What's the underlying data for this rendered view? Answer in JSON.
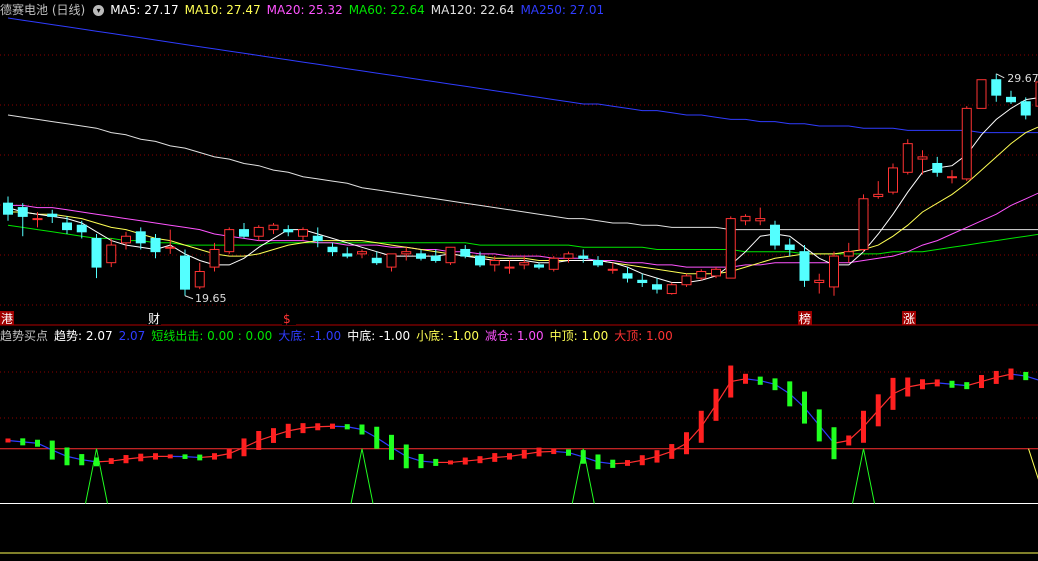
{
  "colors": {
    "up": "#ff3333",
    "down": "#54ffff",
    "ma5": "#ffffff",
    "ma10": "#ffff54",
    "ma20": "#ff54ff",
    "ma60": "#00e600",
    "ma120": "#e0e0e0",
    "ma250": "#2f3cff",
    "grid": "#8b0000",
    "trend_up": "#ff2020",
    "trend_down": "#20ff20",
    "ref_line": "#ff3030",
    "base_line": "#ffffff"
  },
  "header": {
    "title": "德赛电池 (日线)",
    "dropdown_icon": "chevron-down-icon",
    "ma5": "MA5: 27.17",
    "ma10": "MA10: 27.47",
    "ma20": "MA20: 25.32",
    "ma60": "MA60: 22.64",
    "ma120": "MA120: 22.64",
    "ma250": "MA250: 27.01"
  },
  "price_annotations": {
    "high": "29.67",
    "low": "19.65"
  },
  "event_markers": [
    "港",
    "财",
    "$",
    "榜",
    "涨"
  ],
  "indicator_header": {
    "name": "趋势买点",
    "trend": "趋势: 2.07",
    "trend2": "2.07",
    "short_exit": "短线出击: 0.00 : 0.00",
    "big_bottom": "大底: -1.00",
    "mid_bottom": "中底: -1.00",
    "small_bottom": "小底: -1.00",
    "reduce": "减仓: 1.00",
    "mid_top": "中顶: 1.00",
    "big_top": "大顶: 1.00"
  },
  "chart_data": {
    "type": "candlestick",
    "price_panel": {
      "ylim": [
        18.5,
        32.2
      ],
      "candles": [
        [
          23.8,
          24.1,
          23.0,
          23.3
        ],
        [
          23.6,
          23.8,
          22.3,
          23.2
        ],
        [
          23.1,
          23.4,
          22.7,
          23.1
        ],
        [
          23.3,
          23.5,
          22.9,
          23.2
        ],
        [
          22.9,
          23.2,
          22.4,
          22.6
        ],
        [
          22.8,
          23.0,
          22.2,
          22.5
        ],
        [
          22.2,
          22.4,
          20.4,
          20.9
        ],
        [
          21.1,
          22.2,
          20.9,
          21.9
        ],
        [
          22.0,
          22.5,
          21.7,
          22.3
        ],
        [
          22.5,
          22.7,
          21.7,
          22.0
        ],
        [
          22.2,
          22.4,
          21.3,
          21.6
        ],
        [
          21.8,
          22.6,
          21.5,
          21.8
        ],
        [
          21.4,
          21.7,
          19.6,
          19.9
        ],
        [
          20.0,
          21.1,
          19.9,
          20.7
        ],
        [
          20.9,
          22.0,
          20.7,
          21.7
        ],
        [
          21.6,
          22.7,
          21.5,
          22.6
        ],
        [
          22.6,
          22.9,
          22.2,
          22.3
        ],
        [
          22.3,
          22.8,
          22.1,
          22.7
        ],
        [
          22.6,
          22.9,
          22.4,
          22.8
        ],
        [
          22.6,
          22.8,
          22.3,
          22.5
        ],
        [
          22.3,
          22.7,
          22.1,
          22.6
        ],
        [
          22.3,
          22.7,
          21.8,
          22.1
        ],
        [
          21.8,
          22.0,
          21.4,
          21.6
        ],
        [
          21.5,
          21.8,
          21.3,
          21.4
        ],
        [
          21.5,
          21.7,
          21.3,
          21.6
        ],
        [
          21.3,
          21.6,
          21.0,
          21.1
        ],
        [
          20.9,
          21.5,
          20.7,
          21.5
        ],
        [
          21.5,
          21.8,
          21.2,
          21.6
        ],
        [
          21.5,
          21.7,
          21.2,
          21.3
        ],
        [
          21.4,
          21.7,
          21.1,
          21.2
        ],
        [
          21.1,
          21.8,
          21.0,
          21.8
        ],
        [
          21.7,
          21.9,
          21.3,
          21.4
        ],
        [
          21.4,
          21.6,
          20.9,
          21.0
        ],
        [
          21.0,
          21.4,
          20.7,
          21.2
        ],
        [
          20.9,
          21.2,
          20.6,
          20.9
        ],
        [
          21.0,
          21.4,
          20.8,
          21.1
        ],
        [
          21.0,
          21.1,
          20.8,
          20.9
        ],
        [
          20.8,
          21.4,
          20.7,
          21.3
        ],
        [
          21.3,
          21.6,
          21.1,
          21.5
        ],
        [
          21.4,
          21.7,
          21.1,
          21.3
        ],
        [
          21.2,
          21.4,
          20.9,
          21.0
        ],
        [
          20.8,
          21.1,
          20.6,
          20.8
        ],
        [
          20.6,
          20.9,
          20.2,
          20.4
        ],
        [
          20.3,
          20.6,
          20.0,
          20.2
        ],
        [
          20.1,
          20.4,
          19.7,
          19.9
        ],
        [
          19.7,
          20.2,
          19.65,
          20.1
        ],
        [
          20.1,
          20.6,
          20.0,
          20.5
        ],
        [
          20.4,
          20.8,
          20.3,
          20.7
        ],
        [
          20.5,
          20.9,
          20.4,
          20.8
        ],
        [
          20.4,
          23.2,
          20.4,
          23.1
        ],
        [
          23.0,
          23.3,
          22.8,
          23.2
        ],
        [
          23.0,
          23.6,
          22.8,
          23.1
        ],
        [
          22.8,
          23.0,
          21.7,
          21.9
        ],
        [
          21.9,
          22.2,
          21.4,
          21.7
        ],
        [
          21.6,
          21.9,
          20.0,
          20.3
        ],
        [
          20.2,
          20.6,
          19.7,
          20.3
        ],
        [
          20.0,
          21.6,
          19.6,
          21.4
        ],
        [
          21.4,
          22.0,
          21.1,
          21.6
        ],
        [
          21.7,
          24.2,
          21.6,
          24.0
        ],
        [
          24.1,
          24.8,
          24.0,
          24.2
        ],
        [
          24.3,
          25.6,
          24.2,
          25.4
        ],
        [
          25.2,
          26.7,
          25.1,
          26.5
        ],
        [
          25.8,
          26.2,
          25.1,
          25.9
        ],
        [
          25.6,
          25.9,
          25.0,
          25.2
        ],
        [
          25.0,
          25.3,
          24.7,
          25.0
        ],
        [
          24.9,
          28.2,
          24.8,
          28.1
        ],
        [
          28.1,
          29.4,
          28.1,
          29.4
        ],
        [
          29.4,
          29.67,
          28.4,
          28.7
        ],
        [
          28.6,
          28.9,
          28.3,
          28.4
        ],
        [
          28.4,
          28.6,
          27.6,
          27.8
        ],
        [
          28.2,
          29.4,
          28.0,
          29.3
        ],
        [
          28.9,
          29.0,
          27.5,
          27.8
        ],
        [
          26.7,
          27.3,
          26.4,
          27.0
        ],
        [
          26.9,
          27.1,
          25.8,
          26.1
        ]
      ],
      "ma5": [
        23.6,
        23.4,
        23.3,
        23.2,
        23.1,
        22.9,
        22.5,
        22.1,
        21.9,
        21.8,
        21.7,
        21.9,
        21.5,
        21.2,
        21.0,
        21.0,
        21.3,
        21.8,
        22.2,
        22.6,
        22.6,
        22.4,
        22.2,
        22.0,
        21.8,
        21.6,
        21.4,
        21.4,
        21.4,
        21.4,
        21.5,
        21.4,
        21.3,
        21.2,
        21.2,
        21.2,
        21.1,
        21.1,
        21.2,
        21.2,
        21.2,
        21.1,
        20.9,
        20.6,
        20.4,
        20.2,
        20.2,
        20.3,
        20.5,
        21.0,
        21.6,
        22.3,
        22.4,
        22.3,
        21.8,
        21.3,
        21.0,
        21.0,
        21.6,
        22.4,
        23.3,
        24.3,
        25.2,
        25.4,
        25.5,
        26.0,
        26.9,
        27.6,
        28.1,
        28.5,
        28.6,
        28.4,
        28.1,
        27.6
      ],
      "ma10": [
        23.4,
        23.4,
        23.3,
        23.3,
        23.2,
        23.1,
        22.9,
        22.7,
        22.6,
        22.4,
        22.2,
        22.1,
        21.9,
        21.7,
        21.5,
        21.4,
        21.4,
        21.5,
        21.7,
        21.9,
        22.0,
        22.1,
        22.1,
        22.1,
        22.1,
        22.0,
        21.9,
        21.8,
        21.7,
        21.6,
        21.5,
        21.4,
        21.4,
        21.3,
        21.3,
        21.3,
        21.2,
        21.2,
        21.2,
        21.2,
        21.2,
        21.1,
        21.0,
        20.9,
        20.8,
        20.7,
        20.6,
        20.6,
        20.6,
        20.7,
        20.9,
        21.1,
        21.3,
        21.4,
        21.5,
        21.5,
        21.5,
        21.6,
        21.7,
        21.9,
        22.3,
        22.8,
        23.4,
        23.8,
        24.2,
        24.7,
        25.3,
        25.9,
        26.5,
        27.0,
        27.3,
        27.5,
        27.5,
        27.4
      ],
      "ma20": [
        23.7,
        23.7,
        23.6,
        23.6,
        23.5,
        23.4,
        23.3,
        23.2,
        23.1,
        23.0,
        22.9,
        22.8,
        22.7,
        22.6,
        22.4,
        22.3,
        22.2,
        22.1,
        22.1,
        22.1,
        22.1,
        22.0,
        22.0,
        21.9,
        21.9,
        21.9,
        21.8,
        21.8,
        21.7,
        21.7,
        21.6,
        21.6,
        21.5,
        21.5,
        21.4,
        21.4,
        21.4,
        21.3,
        21.3,
        21.3,
        21.2,
        21.2,
        21.1,
        21.1,
        21.0,
        21.0,
        20.9,
        20.9,
        20.9,
        20.9,
        21.0,
        21.0,
        21.1,
        21.1,
        21.1,
        21.1,
        21.1,
        21.1,
        21.2,
        21.3,
        21.4,
        21.6,
        21.9,
        22.1,
        22.4,
        22.7,
        23.0,
        23.3,
        23.7,
        24.0,
        24.3,
        24.6,
        24.9,
        25.3
      ],
      "ma60": [
        22.8,
        22.7,
        22.6,
        22.5,
        22.4,
        22.3,
        22.2,
        22.2,
        22.1,
        22.1,
        22.0,
        22.0,
        21.9,
        21.9,
        21.9,
        21.9,
        21.9,
        21.9,
        22.0,
        22.0,
        22.0,
        22.0,
        22.0,
        22.0,
        22.0,
        22.0,
        22.0,
        22.0,
        22.0,
        22.0,
        22.0,
        22.0,
        21.9,
        21.9,
        21.9,
        21.9,
        21.9,
        21.9,
        21.9,
        21.8,
        21.8,
        21.8,
        21.8,
        21.8,
        21.7,
        21.7,
        21.7,
        21.7,
        21.7,
        21.7,
        21.6,
        21.6,
        21.6,
        21.6,
        21.5,
        21.5,
        21.5,
        21.5,
        21.5,
        21.5,
        21.6,
        21.6,
        21.6,
        21.7,
        21.8,
        21.9,
        22.0,
        22.1,
        22.2,
        22.3,
        22.4,
        22.5,
        22.6,
        22.6
      ],
      "ma120": [
        27.8,
        27.7,
        27.6,
        27.5,
        27.4,
        27.3,
        27.2,
        27.0,
        26.9,
        26.7,
        26.6,
        26.4,
        26.3,
        26.1,
        25.9,
        25.8,
        25.6,
        25.5,
        25.3,
        25.2,
        25.0,
        24.9,
        24.8,
        24.7,
        24.5,
        24.4,
        24.3,
        24.2,
        24.1,
        24.0,
        23.9,
        23.8,
        23.7,
        23.6,
        23.5,
        23.4,
        23.3,
        23.2,
        23.1,
        23.1,
        23.0,
        22.9,
        22.9,
        22.8,
        22.8,
        22.7,
        22.7,
        22.7,
        22.7,
        22.6,
        22.6,
        22.6,
        22.6,
        22.6,
        22.6,
        22.6,
        22.6,
        22.6,
        22.6,
        22.6,
        22.6,
        22.6,
        22.6,
        22.6,
        22.6,
        22.6,
        22.6,
        22.6,
        22.6,
        22.6,
        22.6,
        22.6,
        22.6,
        22.64
      ],
      "ma250": [
        32.2,
        32.1,
        32.0,
        31.9,
        31.8,
        31.7,
        31.6,
        31.5,
        31.4,
        31.3,
        31.2,
        31.1,
        31.0,
        30.9,
        30.8,
        30.7,
        30.6,
        30.5,
        30.4,
        30.3,
        30.2,
        30.1,
        30.0,
        29.9,
        29.8,
        29.7,
        29.6,
        29.5,
        29.4,
        29.3,
        29.2,
        29.1,
        29.0,
        28.9,
        28.8,
        28.7,
        28.6,
        28.5,
        28.4,
        28.3,
        28.3,
        28.2,
        28.1,
        28.0,
        28.0,
        27.9,
        27.8,
        27.8,
        27.7,
        27.6,
        27.6,
        27.5,
        27.5,
        27.4,
        27.4,
        27.3,
        27.3,
        27.3,
        27.2,
        27.2,
        27.2,
        27.1,
        27.1,
        27.1,
        27.1,
        27.1,
        27.0,
        27.0,
        27.0,
        27.0,
        27.0,
        27.0,
        27.0,
        27.01
      ]
    },
    "indicator_panel": {
      "ylim": [
        -1.6,
        4.6
      ],
      "trend": [
        1.3,
        1.25,
        1.2,
        0.95,
        0.72,
        0.6,
        0.52,
        0.55,
        0.62,
        0.68,
        0.72,
        0.72,
        0.71,
        0.68,
        0.72,
        0.82,
        1.05,
        1.3,
        1.48,
        1.65,
        1.75,
        1.8,
        1.82,
        1.8,
        1.7,
        1.4,
        1.05,
        0.72,
        0.55,
        0.5,
        0.5,
        0.55,
        0.6,
        0.68,
        0.72,
        0.8,
        0.88,
        0.9,
        0.86,
        0.7,
        0.52,
        0.45,
        0.48,
        0.58,
        0.72,
        0.9,
        1.2,
        1.8,
        2.6,
        3.45,
        3.55,
        3.48,
        3.35,
        3.0,
        2.5,
        1.85,
        1.2,
        1.3,
        1.8,
        2.4,
        3.0,
        3.25,
        3.35,
        3.4,
        3.35,
        3.3,
        3.45,
        3.6,
        3.72,
        3.65,
        3.48,
        3.35,
        3.2,
        2.7
      ],
      "big_bottom": [
        -1.0,
        -1.0
      ],
      "mid_bottom": [
        -1.0,
        -1.0
      ],
      "small_bottom": [
        -1.0,
        -1.0
      ],
      "reduce": [
        1.0,
        1.0
      ],
      "mid_top": [
        1.0,
        1.0
      ],
      "big_top": [
        1.0,
        1.0
      ],
      "signal_markers": [
        6,
        24,
        39,
        58,
        73
      ]
    }
  }
}
